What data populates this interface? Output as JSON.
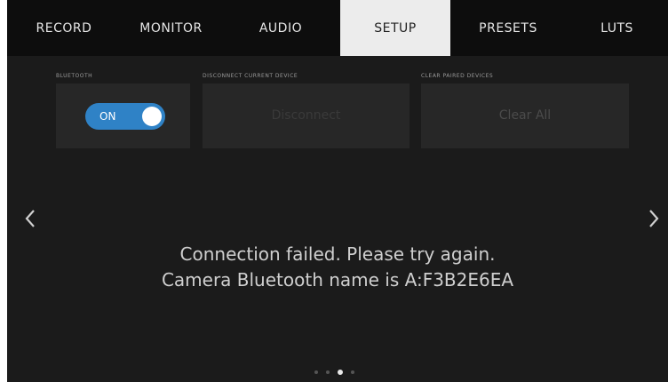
{
  "tabs": [
    {
      "label": "RECORD",
      "active": false
    },
    {
      "label": "MONITOR",
      "active": false
    },
    {
      "label": "AUDIO",
      "active": false
    },
    {
      "label": "SETUP",
      "active": true
    },
    {
      "label": "PRESETS",
      "active": false
    },
    {
      "label": "LUTS",
      "active": false
    }
  ],
  "bluetooth": {
    "label": "BLUETOOTH",
    "toggle_text": "ON",
    "toggle_state": "on"
  },
  "disconnect": {
    "label": "DISCONNECT CURRENT DEVICE",
    "button_label": "Disconnect",
    "enabled": false
  },
  "clear_paired": {
    "label": "CLEAR PAIRED DEVICES",
    "button_label": "Clear All",
    "enabled": false
  },
  "message": {
    "line1": "Connection failed. Please try again.",
    "line2": "Camera Bluetooth name is A:F3B2E6EA"
  },
  "nav": {
    "prev_icon": "chevron-left-icon",
    "next_icon": "chevron-right-icon"
  },
  "pagination": {
    "total": 4,
    "current": 3
  },
  "colors": {
    "accent": "#2f82c6",
    "active_tab_bg": "#ececec",
    "background": "#1b1b1b",
    "tabbar_bg": "#0d0d0d"
  }
}
